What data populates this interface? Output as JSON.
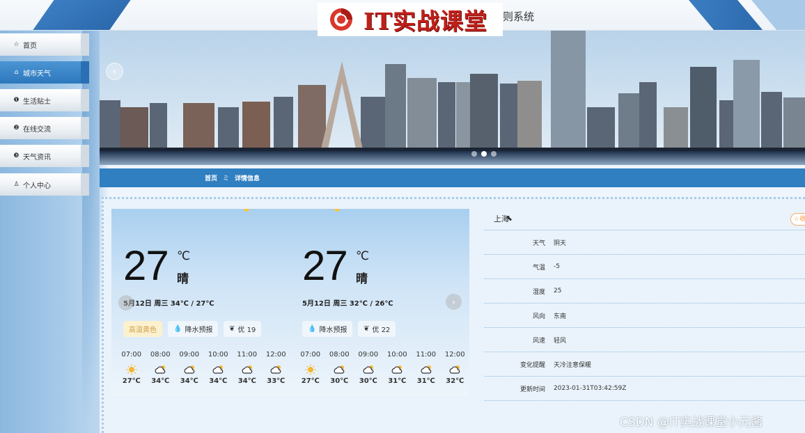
{
  "header": {
    "brand": "IT实战课堂",
    "system_title": "则系统"
  },
  "sidebar": {
    "items": [
      {
        "label": "首页",
        "icon": "star-outline-icon",
        "active": false
      },
      {
        "label": "城市天气",
        "icon": "home-icon",
        "active": true
      },
      {
        "label": "生活贴士",
        "icon": "exclamation-circle-icon",
        "active": false
      },
      {
        "label": "在线交流",
        "icon": "question-circle-icon",
        "active": false
      },
      {
        "label": "天气资讯",
        "icon": "info-circle-icon",
        "active": false
      },
      {
        "label": "个人中心",
        "icon": "user-icon",
        "active": false
      }
    ]
  },
  "breadcrumb": {
    "home": "首页",
    "separator": "ミ",
    "current": "详情信息"
  },
  "weather_card": {
    "days": [
      {
        "temp": "27",
        "unit": "℃",
        "condition": "晴",
        "date": "5月12日 周三   34℃ / 27℃",
        "warning": "高温黄色",
        "rain_label": "降水预报",
        "aqi": "优 19",
        "hours": [
          {
            "time": "07:00",
            "icon": "sun-icon",
            "temp": "27℃"
          },
          {
            "time": "08:00",
            "icon": "partly-cloudy-icon",
            "temp": "34℃"
          },
          {
            "time": "09:00",
            "icon": "partly-cloudy-icon",
            "temp": "34℃"
          },
          {
            "time": "10:00",
            "icon": "partly-cloudy-icon",
            "temp": "34℃"
          },
          {
            "time": "11:00",
            "icon": "partly-cloudy-icon",
            "temp": "34℃"
          },
          {
            "time": "12:00",
            "icon": "partly-cloudy-icon",
            "temp": "33℃"
          }
        ]
      },
      {
        "temp": "27",
        "unit": "℃",
        "condition": "晴",
        "date": "5月12日 周三   32℃ / 26℃",
        "warning": "",
        "rain_label": "降水预报",
        "aqi": "优 22",
        "hours": [
          {
            "time": "07:00",
            "icon": "sun-icon",
            "temp": "27℃"
          },
          {
            "time": "08:00",
            "icon": "partly-cloudy-icon",
            "temp": "30℃"
          },
          {
            "time": "09:00",
            "icon": "partly-cloudy-icon",
            "temp": "30℃"
          },
          {
            "time": "10:00",
            "icon": "partly-cloudy-icon",
            "temp": "31℃"
          },
          {
            "time": "11:00",
            "icon": "partly-cloudy-icon",
            "temp": "31℃"
          },
          {
            "time": "12:00",
            "icon": "partly-cloudy-icon",
            "temp": "32℃"
          }
        ]
      }
    ]
  },
  "info": {
    "city": "上海",
    "favorite": "☆收",
    "rows": [
      {
        "label": "天气",
        "value": "阴天"
      },
      {
        "label": "气温",
        "value": "-5"
      },
      {
        "label": "湿度",
        "value": "25"
      },
      {
        "label": "风向",
        "value": "东南"
      },
      {
        "label": "风速",
        "value": "轻风"
      },
      {
        "label": "变化提醒",
        "value": "天冷注意保暖"
      },
      {
        "label": "更新时间",
        "value": "2023-01-31T03:42:59Z"
      }
    ]
  },
  "carousel": {
    "dots": 3,
    "active_dot": 2
  },
  "watermark": "CSDN @IT实战课堂小元酱",
  "colors": {
    "primary": "#2f7fc1",
    "brand_red": "#c0201a",
    "warning_chip": "#fbf1cf"
  }
}
